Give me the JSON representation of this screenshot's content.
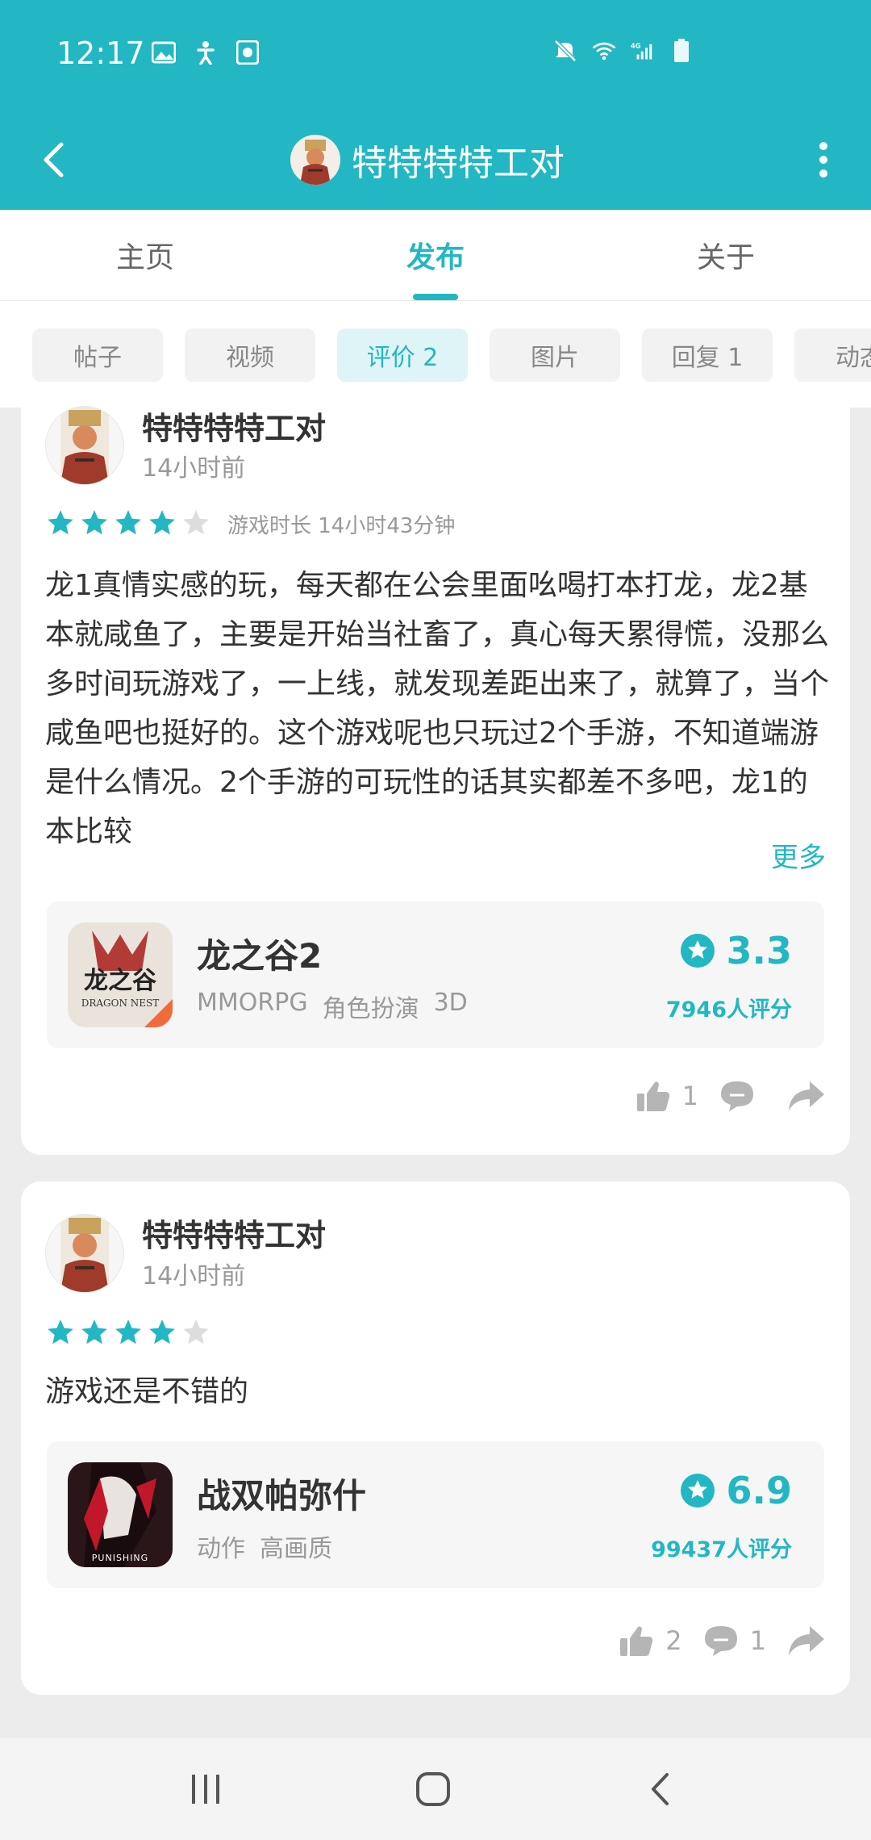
{
  "status_bar": {
    "time": "12:17",
    "left_icons": [
      "image-icon",
      "accessibility-icon",
      "screen-record-icon"
    ],
    "right_icons": [
      "mute-icon",
      "wifi-icon",
      "signal-4g-icon",
      "battery-icon"
    ]
  },
  "header": {
    "title": "特特特特工对",
    "back_icon": "back-chevron-icon",
    "menu_icon": "more-vertical-icon"
  },
  "tabs": [
    {
      "label": "主页",
      "active": false
    },
    {
      "label": "发布",
      "active": true
    },
    {
      "label": "关于",
      "active": false
    }
  ],
  "filters": [
    {
      "label": "帖子",
      "active": false
    },
    {
      "label": "视频",
      "active": false
    },
    {
      "label": "评价 2",
      "active": true
    },
    {
      "label": "图片",
      "active": false
    },
    {
      "label": "回复 1",
      "active": false
    },
    {
      "label": "动态",
      "active": false
    }
  ],
  "reviews": [
    {
      "author": "特特特特工对",
      "time": "14小时前",
      "rating": 4,
      "playtime": "游戏时长 14小时43分钟",
      "text": "龙1真情实感的玩，每天都在公会里面吆喝打本打龙，龙2基本就咸鱼了，主要是开始当社畜了，真心每天累得慌，没那么多时间玩游戏了，一上线，就发现差距出来了，就算了，当个咸鱼吧也挺好的。这个游戏呢也只玩过2个手游，不知道端游是什么情况。2个手游的可玩性的话其实都差不多吧，龙1的本比较",
      "more_label": "更多",
      "game": {
        "name": "龙之谷2",
        "tags": [
          "MMORPG",
          "角色扮演",
          "3D"
        ],
        "score": "3.3",
        "count": "7946人评分",
        "icon_text": "龙之谷"
      },
      "likes": "1",
      "comments": ""
    },
    {
      "author": "特特特特工对",
      "time": "14小时前",
      "rating": 4,
      "playtime": "",
      "text": "游戏还是不错的",
      "more_label": "",
      "game": {
        "name": "战双帕弥什",
        "tags": [
          "动作",
          "高画质"
        ],
        "score": "6.9",
        "count": "99437人评分",
        "icon_text": "PUNISHING"
      },
      "likes": "2",
      "comments": "1"
    }
  ],
  "nav_bar": [
    "recent-apps-icon",
    "home-icon",
    "back-icon"
  ],
  "colors": {
    "accent": "#22b7c2",
    "star_off": "#dddddd"
  }
}
